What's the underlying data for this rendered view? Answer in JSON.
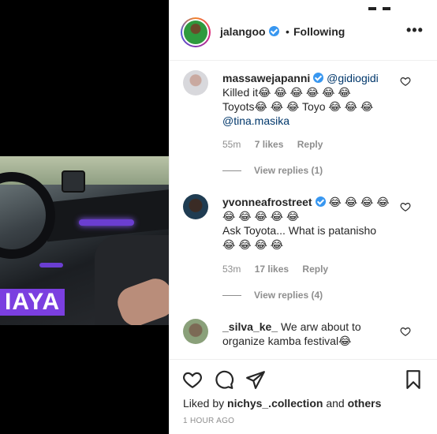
{
  "video": {
    "caption": "IAYA"
  },
  "header": {
    "username": "jalangoo",
    "separator": "•",
    "follow_status": "Following",
    "more_label": "•••"
  },
  "comments": [
    {
      "username": "massawejapanni",
      "mention": "@gidiogidi",
      "line1": "Killed it😂 😂 😂 😂 😂 😂",
      "line2": "Toyots😂 😂 😂  Toyo 😂 😂 😂",
      "mention2": "@tina.masika",
      "time": "55m",
      "likes": "7 likes",
      "reply": "Reply",
      "view_replies": "View replies (1)"
    },
    {
      "username": "yvonneafrostreet",
      "emojis_inline": "😂 😂 😂 😂",
      "line1": "😂 😂 😂 😂 😂",
      "line2": "Ask Toyota... What is patanisho",
      "line3": "😂 😂 😂 😂",
      "time": "53m",
      "likes": "17 likes",
      "reply": "Reply",
      "view_replies": "View replies (4)"
    },
    {
      "username": "_silva_ke_",
      "text1": "We arw about to",
      "text2": "organize kamba festival😂"
    }
  ],
  "actions": {
    "liked_by_prefix": "Liked by",
    "liked_by_user": "nichys_.collection",
    "liked_by_and": "and",
    "liked_by_others": "others",
    "time_ago": "1 HOUR AGO"
  },
  "icons": {
    "heart": "heart-icon",
    "comment": "comment-icon",
    "share": "share-icon",
    "save": "bookmark-icon",
    "verified": "verified-badge-icon"
  },
  "colors": {
    "verified": "#3897f0",
    "mention": "#00376b",
    "muted": "#8e8e8e",
    "caption_bg": "#7b3fe0"
  }
}
